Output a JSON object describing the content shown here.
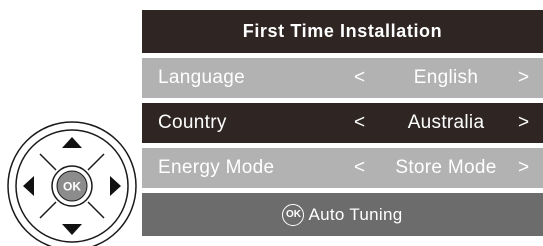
{
  "menu": {
    "title": "First Time Installation",
    "rows": [
      {
        "label": "Language",
        "value": "English",
        "prev_arrow": "<",
        "next_arrow": ">"
      },
      {
        "label": "Country",
        "value": "Australia",
        "prev_arrow": "<",
        "next_arrow": ">"
      },
      {
        "label": "Energy Mode",
        "value": "Store Mode",
        "prev_arrow": "<",
        "next_arrow": ">"
      }
    ],
    "auto_tuning": {
      "badge": "OK",
      "label": "Auto Tuning"
    }
  },
  "remote": {
    "center_label": "OK"
  }
}
